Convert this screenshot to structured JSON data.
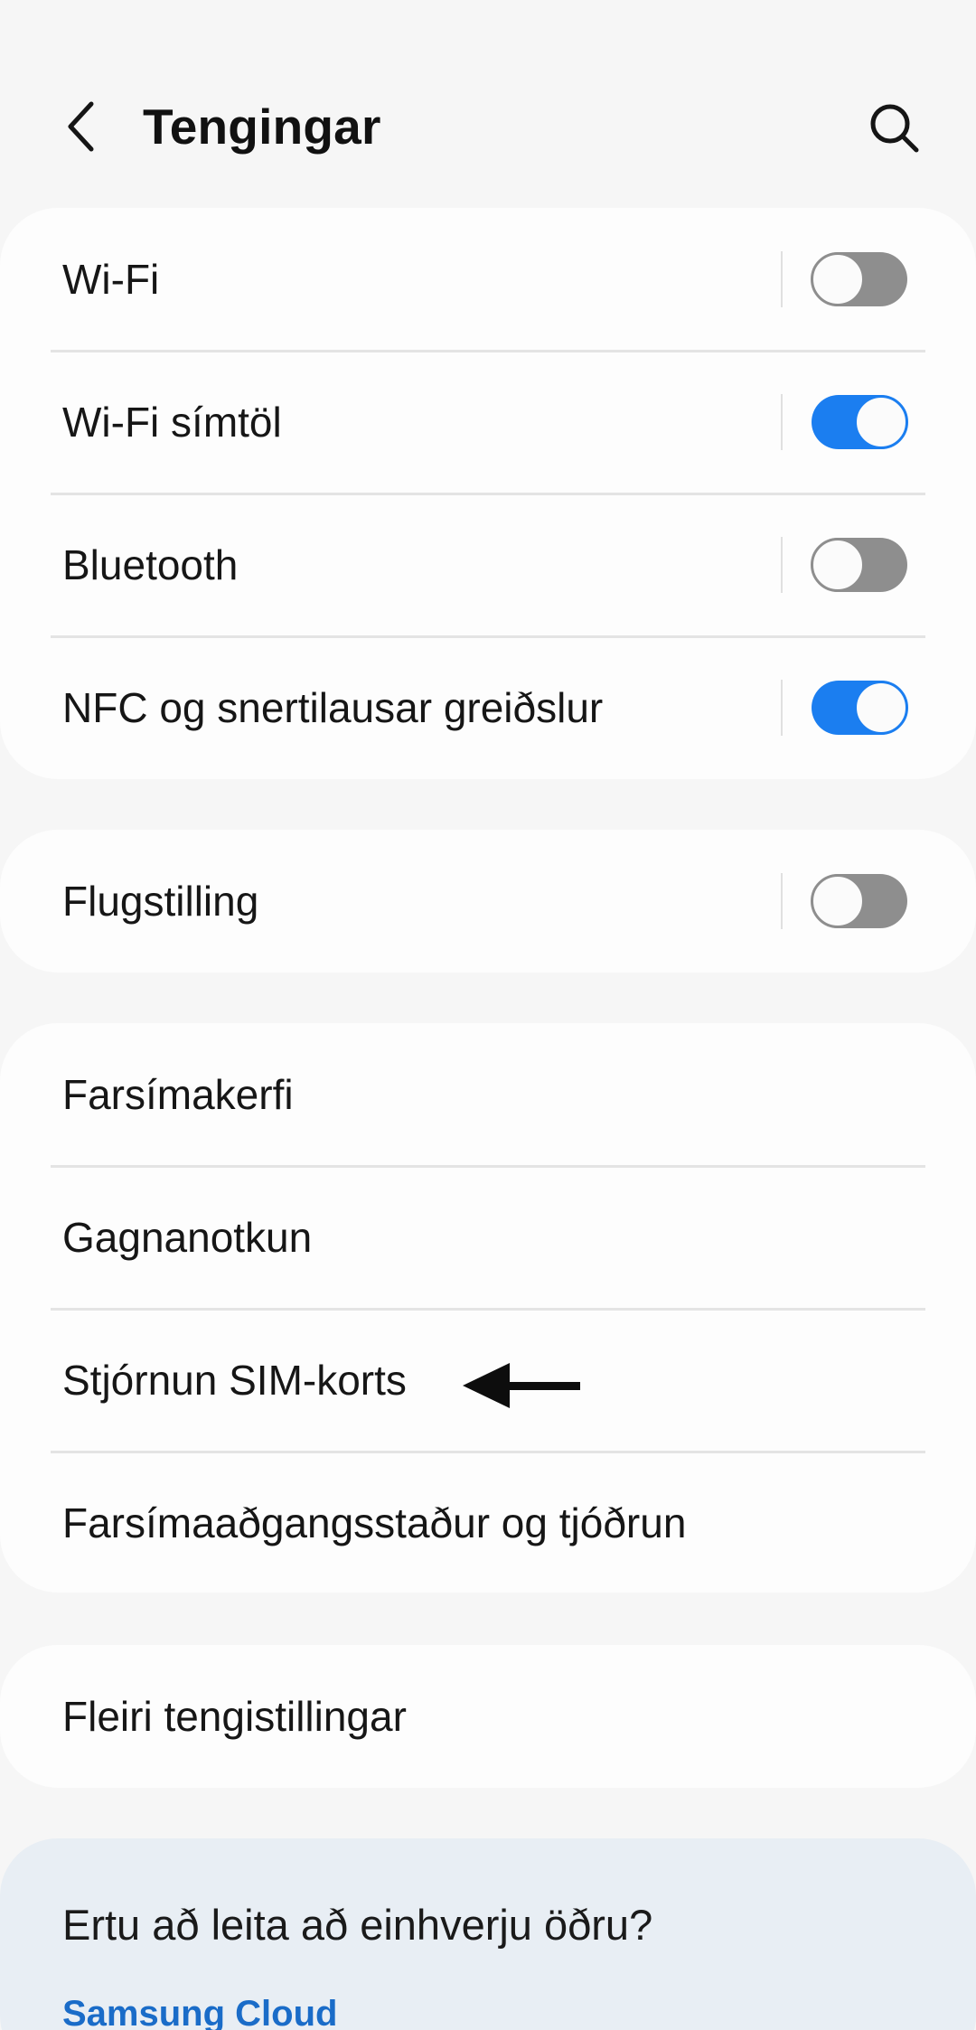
{
  "header": {
    "title": "Tengingar",
    "back_icon": "chevron-left-icon",
    "search_icon": "search-icon"
  },
  "groups": {
    "connections": [
      {
        "label": "Wi-Fi",
        "toggle": false
      },
      {
        "label": "Wi-Fi símtöl",
        "toggle": true
      },
      {
        "label": "Bluetooth",
        "toggle": false
      },
      {
        "label": "NFC og snertilausar greiðslur",
        "toggle": true
      }
    ],
    "airplane": [
      {
        "label": "Flugstilling",
        "toggle": false
      }
    ],
    "network": [
      {
        "label": "Farsímakerfi"
      },
      {
        "label": "Gagnanotkun"
      },
      {
        "label": "Stjórnun SIM-korts"
      },
      {
        "label": "Farsímaaðgangsstaður og tjóðrun"
      }
    ],
    "more": [
      {
        "label": "Fleiri tengistillingar"
      }
    ]
  },
  "suggestions": {
    "title": "Ertu að leita að einhverju öðru?",
    "link": "Samsung Cloud"
  },
  "colors": {
    "accent": "#1b7ef0",
    "toggle_off": "#8e8e8e",
    "link": "#1a6cc8"
  }
}
